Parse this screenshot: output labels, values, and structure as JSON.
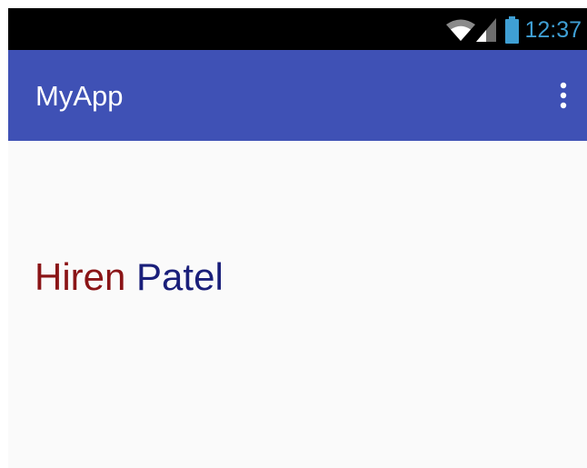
{
  "status_bar": {
    "time": "12:37",
    "icons": [
      "wifi-icon",
      "signal-icon",
      "battery-icon"
    ],
    "clock_color": "#3f9fd4",
    "background": "#000000"
  },
  "app_bar": {
    "title": "MyApp",
    "background": "#3f51b5",
    "overflow_icon": "more-vert-icon"
  },
  "content": {
    "first_name": "Hiren",
    "last_name": "Patel",
    "first_name_color": "#8a1416",
    "last_name_color": "#1a1f7a"
  }
}
